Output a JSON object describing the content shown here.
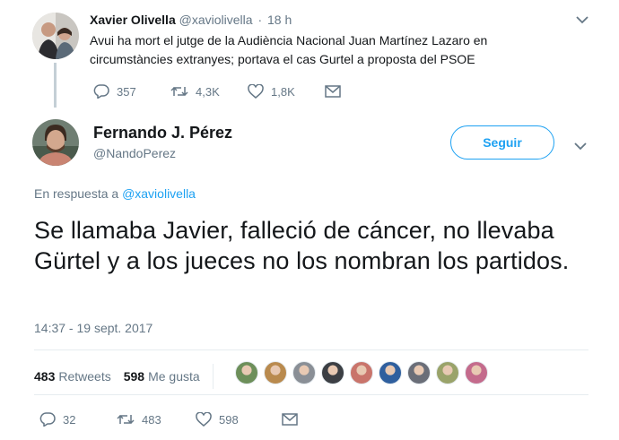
{
  "parent_tweet": {
    "name": "Xavier Olivella",
    "handle": "@xaviolivella",
    "dot": "·",
    "time": "18 h",
    "text": "Avui ha mort el jutge de la Audiència Nacional Juan Martínez Lazaro en circumstàncies extranyes; portava el cas Gurtel a proposta del PSOE",
    "replies": "357",
    "retweets": "4,3K",
    "likes": "1,8K"
  },
  "main_tweet": {
    "name": "Fernando J. Pérez",
    "handle": "@NandoPerez",
    "follow_label": "Seguir",
    "reply_prefix": "En respuesta a",
    "reply_to": "@xaviolivella",
    "text": "Se llamaba Javier, falleció de cáncer, no llevaba Gürtel y a los jueces no los nombran los partidos.",
    "timestamp": "14:37 - 19 sept. 2017",
    "retweet_count": "483",
    "retweet_label": "Retweets",
    "like_count": "598",
    "like_label": "Me gusta",
    "replies": "32",
    "retweets": "483",
    "likes": "598"
  },
  "likers": [
    "#6d8f5a",
    "#b98a4e",
    "#8a8f96",
    "#3c3f44",
    "#c9746b",
    "#2f5f9e",
    "#6a6e78",
    "#9aa36a",
    "#c46b8c"
  ],
  "colors": {
    "accent": "#1da1f2",
    "muted": "#657786",
    "text": "#14171a",
    "divider": "#e6ecf0"
  }
}
